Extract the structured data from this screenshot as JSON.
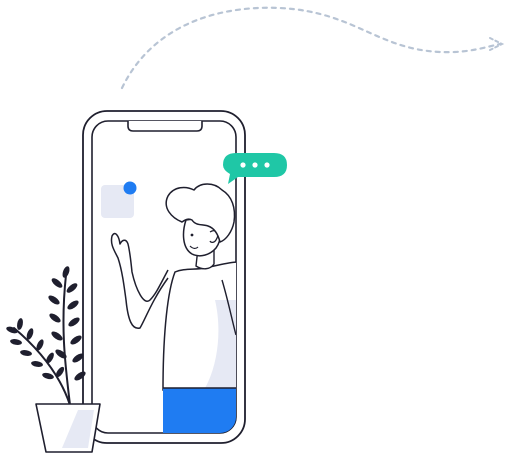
{
  "colors": {
    "stroke": "#1f1f2e",
    "accent_green": "#1fc7a6",
    "accent_blue": "#1f7cf2",
    "notification_dot": "#1f7cf2",
    "app_tile": "#e6e9f4",
    "shade": "#e6e9f4",
    "dashed_path": "#b8c4d4",
    "background": "#ffffff"
  },
  "icons": {
    "chat_bubble": "chat-bubble-icon",
    "typing_dots": "ellipsis-icon",
    "notification": "notification-dot-icon"
  }
}
